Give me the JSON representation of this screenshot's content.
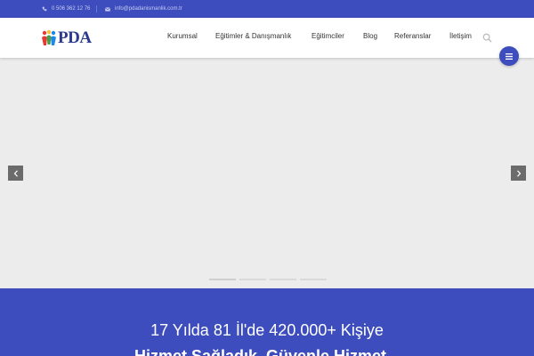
{
  "topbar": {
    "phone": "0 506 362 12 76",
    "email": "info@pdadanismanlik.com.tr"
  },
  "brand": {
    "logo_text": "PDA",
    "accent": "#3d4dbe"
  },
  "nav": {
    "items": [
      {
        "label": "Kurumsal"
      },
      {
        "label": "Eğitimler & Danışmanlık"
      },
      {
        "label": "Eğitimciler"
      },
      {
        "label": "Blog"
      },
      {
        "label": "Referanslar"
      },
      {
        "label": "İletişim"
      }
    ],
    "search_icon": "search-icon",
    "menu_icon": "hamburger-icon"
  },
  "slider": {
    "prev_icon": "chevron-left-icon",
    "next_icon": "chevron-right-icon",
    "slide_count": 4,
    "active_slide": 1
  },
  "band": {
    "headline": "17 Yılda 81 İl'de 420.000+ Kişiye",
    "subline": "Hizmet Sağladık, Güvenle Hizmet..."
  }
}
